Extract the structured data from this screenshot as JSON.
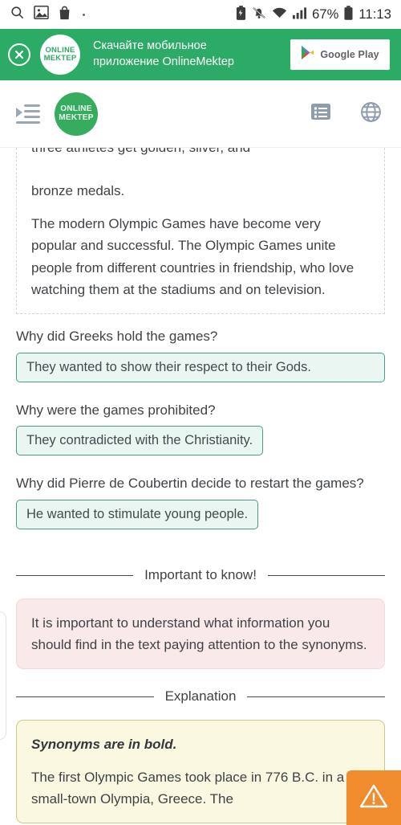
{
  "statusbar": {
    "icons_left": [
      "search-icon",
      "image-icon",
      "shopping-bag-icon"
    ],
    "icons_right": [
      "battery-saver-icon",
      "mute-bell-icon",
      "wifi-icon",
      "signal-icon"
    ],
    "battery_percent": "67%",
    "time": "11:13"
  },
  "banner": {
    "close_label": "×",
    "logo_line1": "ONLINE",
    "logo_line2": "MEKTEP",
    "text_line1": "Скачайте мобильное",
    "text_line2": "приложение OnlineMektep",
    "store_button_label": "Google Play",
    "bg_color": "#2bab65"
  },
  "appbar": {
    "menu_icon": "hamburger-menu-icon",
    "logo_line1": "ONLINE",
    "logo_line2": "MEKTEP",
    "list_icon": "list-view-icon",
    "globe_icon": "globe-language-icon",
    "icon_color": "#8e9cad"
  },
  "passage": {
    "clipped_line": "three athletes get golden, silver, and",
    "paragraph1_rest": "bronze medals.",
    "paragraph2": "The modern Olympic Games have become very popular and successful. The Olympic Games unite people from different countries in friendship, who love watching them at the stadiums and on television."
  },
  "questions": [
    {
      "prompt": "Why did Greeks hold the games?",
      "answer": "They wanted to show their respect to their Gods."
    },
    {
      "prompt": "Why were the games prohibited?",
      "answer": "They contradicted with the Christianity."
    },
    {
      "prompt": "Why did Pierre de Coubertin decide to restart the games?",
      "answer": "He wanted to stimulate young people."
    }
  ],
  "important_section": {
    "divider_label": "Important to know!",
    "body": "It is important to understand what information you should find in the text paying attention to the synonyms.",
    "bg_color": "#fae9e9"
  },
  "explanation_section": {
    "divider_label": "Explanation",
    "bold_title": "Synonyms are in bold.",
    "body": "The first Olympic Games took place in 776 B.C. in a small-town Olympia, Greece. The",
    "bg_color": "#faf8e0"
  },
  "fab": {
    "icon": "warning-triangle-icon",
    "color": "#f08c2e"
  }
}
